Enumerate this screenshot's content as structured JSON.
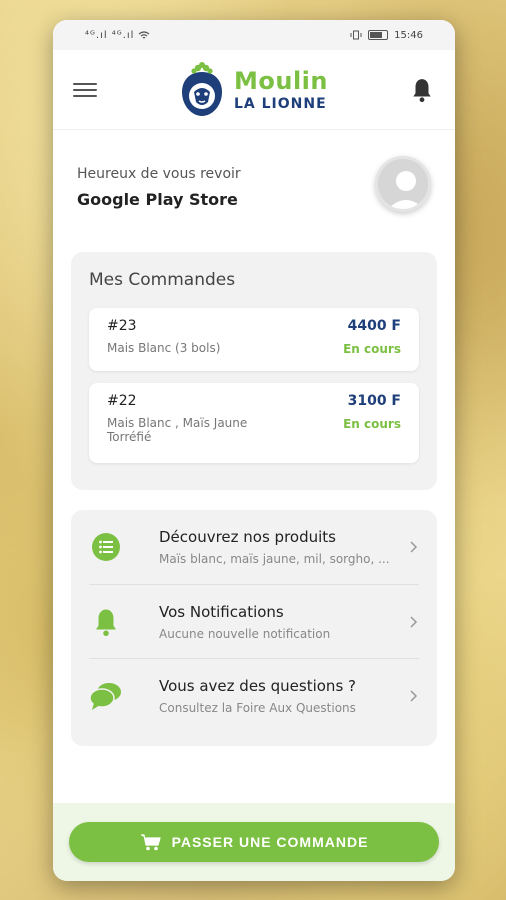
{
  "status_bar": {
    "signal": "⁴ᴳ.ıl ⁴ᴳ.ıl",
    "time": "15:46"
  },
  "app": {
    "logo_title": "Moulin",
    "logo_subtitle": "LA LIONNE"
  },
  "greeting": {
    "subtitle": "Heureux de vous revoir",
    "name": "Google Play Store"
  },
  "orders": {
    "title": "Mes Commandes",
    "items": [
      {
        "number": "#23",
        "description": "Mais Blanc (3 bols)",
        "amount": "4400 F",
        "status": "En cours"
      },
      {
        "number": "#22",
        "description": "Mais Blanc , Maïs Jaune Torréfié",
        "amount": "3100 F",
        "status": "En cours"
      }
    ]
  },
  "menu": [
    {
      "title": "Découvrez nos produits",
      "subtitle": "Maïs blanc, maïs jaune, mil, sorgho, ...",
      "icon": "list-icon"
    },
    {
      "title": "Vos Notifications",
      "subtitle": "Aucune nouvelle notification",
      "icon": "bell-icon"
    },
    {
      "title": "Vous avez des questions ?",
      "subtitle": "Consultez la Foire Aux Questions",
      "icon": "chat-icon"
    }
  ],
  "footer": {
    "button_label": "PASSER UNE COMMANDE",
    "icon": "cart-icon"
  },
  "colors": {
    "brand_green": "#7cc043",
    "brand_blue": "#1e3f7a",
    "card_bg": "#f2f2f2"
  }
}
